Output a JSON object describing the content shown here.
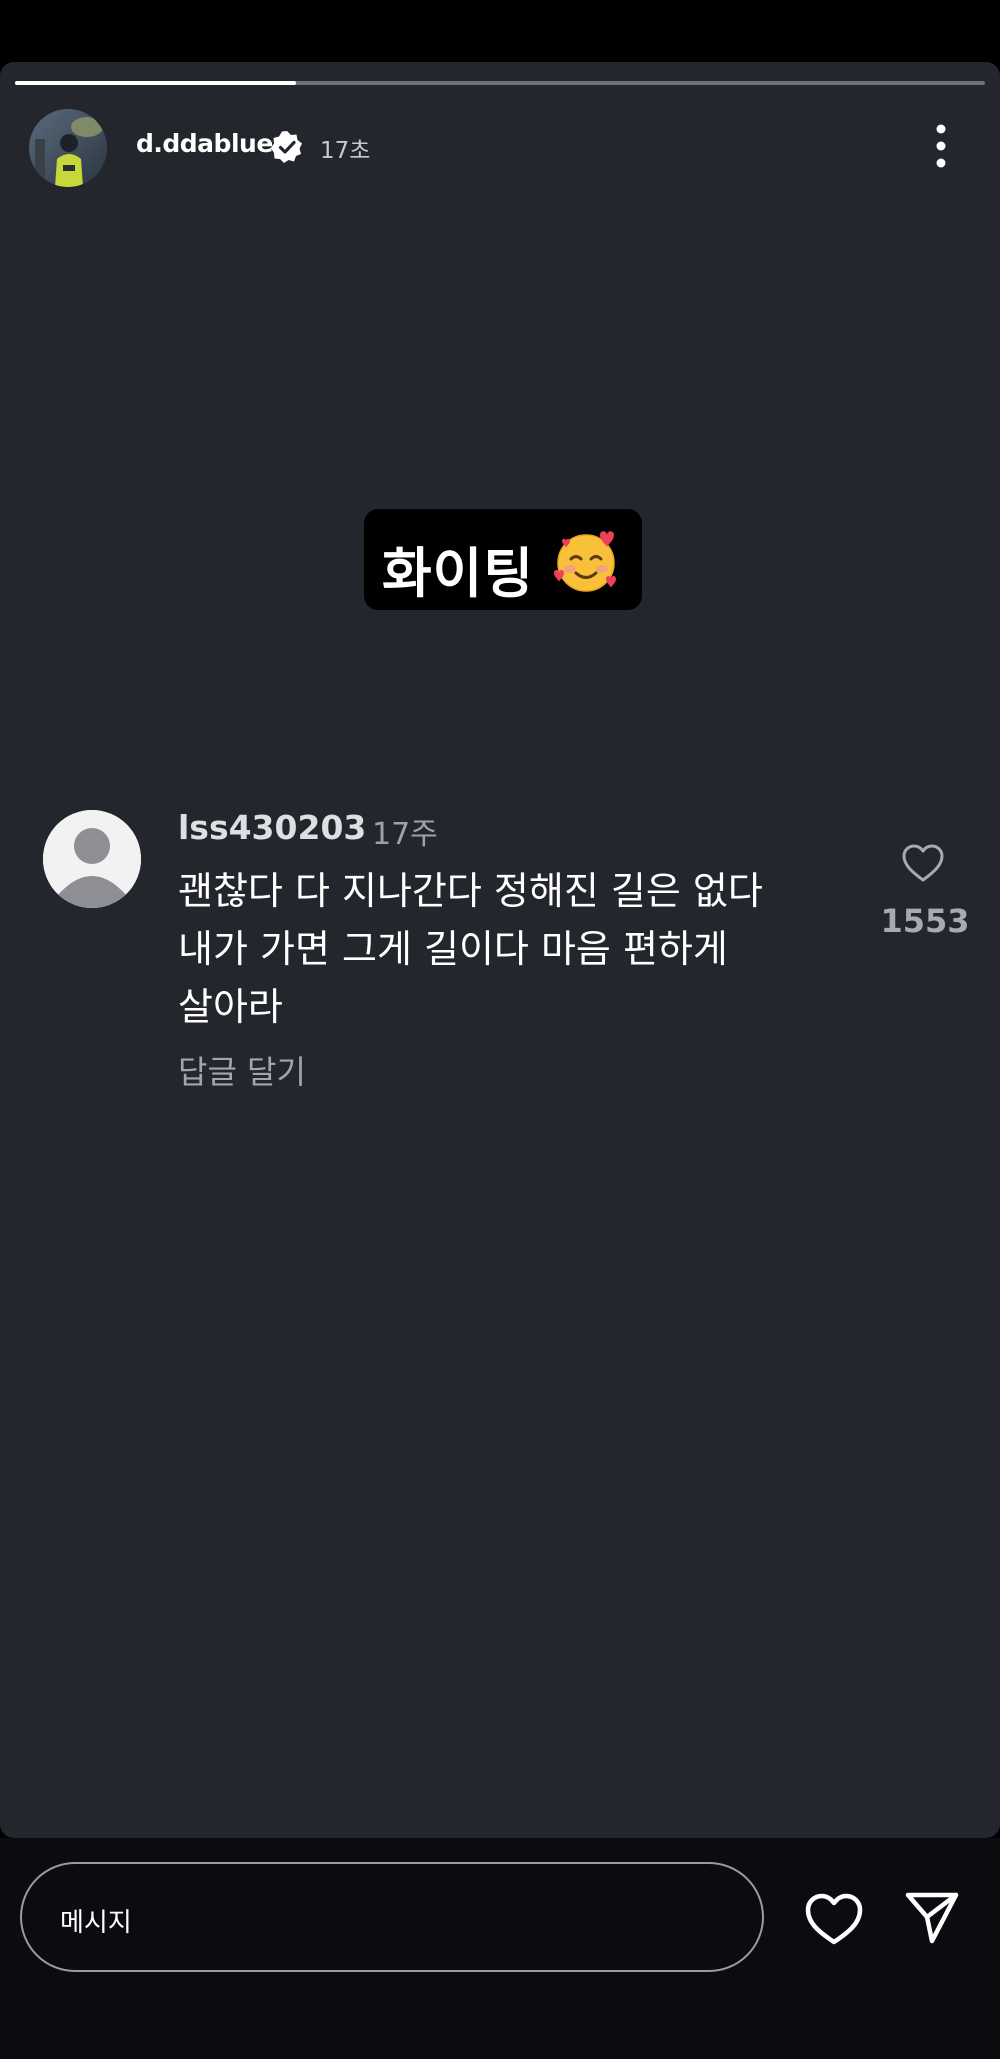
{
  "story": {
    "progress_fraction": 0.29
  },
  "header": {
    "username": "d.ddablue",
    "verified_icon": "verified-badge-icon",
    "time": "17초",
    "more_icon": "more-vertical-icon"
  },
  "sticker": {
    "text": "화이팅",
    "emoji": "smiling-face-with-hearts-emoji"
  },
  "comment": {
    "avatar_icon": "default-profile-icon",
    "username": "lss430203",
    "time": "17주",
    "text": "괜찮다 다 지나간다 정해진 길은 없다\n내가 가면 그게 길이다 마음 편하게\n살아라",
    "reply_label": "답글 달기",
    "like_icon": "heart-outline-icon",
    "like_count": "1553"
  },
  "bottom_bar": {
    "message_placeholder": "메시지",
    "heart_icon": "heart-icon",
    "send_icon": "send-icon"
  }
}
